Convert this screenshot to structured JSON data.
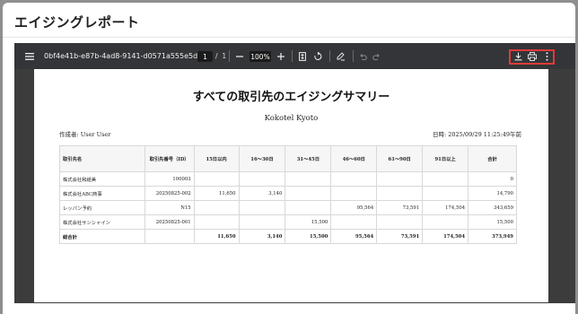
{
  "modal": {
    "title": "エイジングレポート"
  },
  "viewer": {
    "document_name": "0bf4e41b-e87b-4ad8-9141-d0571a555e5d",
    "current_page": "1",
    "page_separator": "/",
    "total_pages": "1",
    "zoom": "100%",
    "icons": [
      "menu-icon",
      "zoom-out-icon",
      "zoom-in-icon",
      "fit-page-icon",
      "rotate-icon",
      "annotate-icon",
      "undo-icon",
      "redo-icon",
      "download-icon",
      "print-icon",
      "more-icon"
    ],
    "highlight_color": "#e03a3a"
  },
  "report": {
    "title": "すべての取引先のエイジングサマリー",
    "company": "Kokotel Kyoto",
    "author": "作成者: User User",
    "date": "日時: 2025/09/29 11:25:49午前",
    "headers": [
      "取引先名",
      "取引先番号（ID）",
      "15日以内",
      "16～30日",
      "31～45日",
      "46～60日",
      "61～90日",
      "91日以上",
      "合計"
    ],
    "rows": [
      [
        "株式会社和紙美",
        "100003",
        "",
        "",
        "",
        "",
        "",
        "",
        "0"
      ],
      [
        "株式会社ABC商事",
        "20250825-002",
        "11,650",
        "3,140",
        "",
        "",
        "",
        "",
        "14,790"
      ],
      [
        "レッパン予約",
        "N15",
        "",
        "",
        "",
        "95,564",
        "73,591",
        "174,504",
        "343,659"
      ],
      [
        "株式会社サンシャイン",
        "20250825-001",
        "",
        "",
        "15,500",
        "",
        "",
        "",
        "15,500"
      ],
      [
        "総合計",
        "",
        "11,650",
        "3,140",
        "15,500",
        "95,564",
        "73,591",
        "174,504",
        "373,949"
      ]
    ]
  }
}
